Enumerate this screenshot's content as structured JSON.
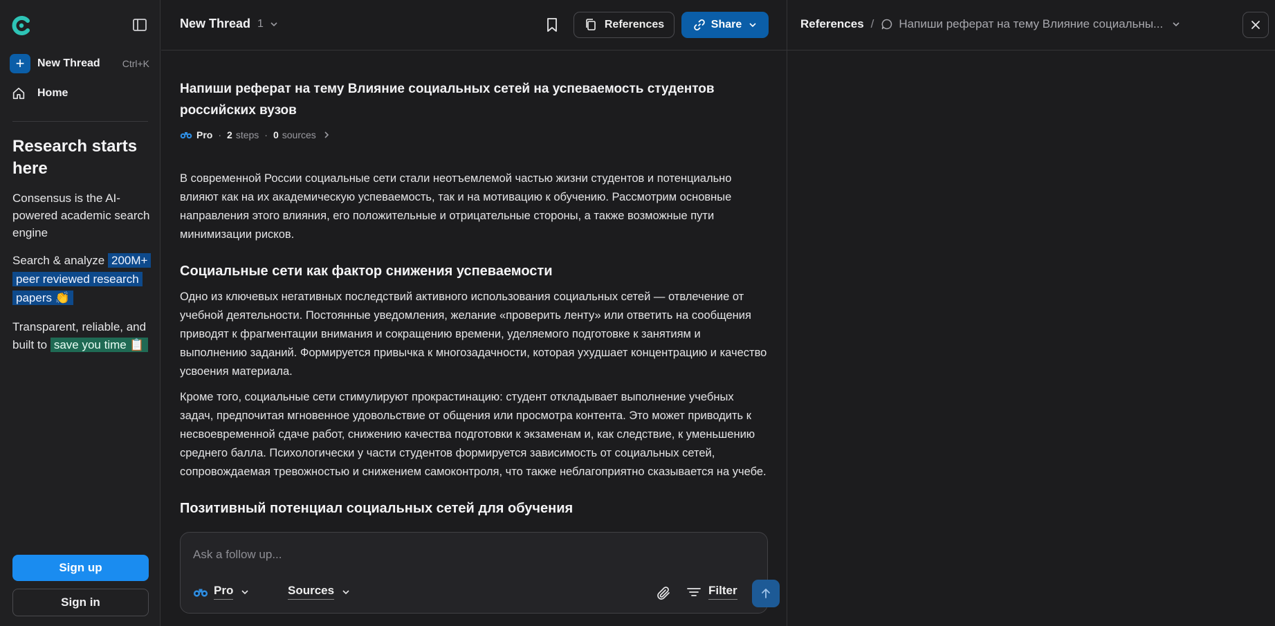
{
  "sidebar": {
    "new_thread_label": "New Thread",
    "new_thread_shortcut": "Ctrl+K",
    "home_label": "Home",
    "promo": {
      "title": "Research starts here",
      "line1": "Consensus is the AI-powered academic search engine",
      "line2_text": "Search & analyze",
      "line2_highlight": "200M+ peer reviewed research papers 👏",
      "line3_text": "Transparent, reliable, and built to",
      "line3_highlight": "save you time 📋"
    },
    "signup_label": "Sign up",
    "signin_label": "Sign in"
  },
  "header": {
    "thread_title": "New Thread",
    "thread_count": "1",
    "references_label": "References",
    "share_label": "Share"
  },
  "thread": {
    "question": "Напиши реферат на тему Влияние социальных сетей на успеваемость студентов российских вузов",
    "meta": {
      "mode": "Pro",
      "steps_count": "2",
      "steps_label": "steps",
      "sources_count": "0",
      "sources_label": "sources"
    },
    "intro": "В современной России социальные сети стали неотъемлемой частью жизни студентов и потенциально влияют как на их академическую успеваемость, так и на мотивацию к обучению. Рассмотрим основные направления этого влияния, его положительные и отрицательные стороны, а также возможные пути минимизации рисков.",
    "section1_heading": "Социальные сети как фактор снижения успеваемости",
    "section1_p1": "Одно из ключевых негативных последствий активного использования социальных сетей — отвлечение от учебной деятельности. Постоянные уведомления, желание «проверить ленту» или ответить на сообщения приводят к фрагментации внимания и сокращению времени, уделяемого подготовке к занятиям и выполнению заданий. Формируется привычка к многозадачности, которая ухудшает концентрацию и качество усвоения материала.",
    "section1_p2": "Кроме того, социальные сети стимулируют прокрастинацию: студент откладывает выполнение учебных задач, предпочитая мгновенное удовольствие от общения или просмотра контента. Это может приводить к несвоевременной сдаче работ, снижению качества подготовки к экзаменам и, как следствие, к уменьшению среднего балла. Психологически у части студентов формируется зависимость от социальных сетей, сопровождаемая тревожностью и снижением самоконтроля, что также неблагоприятно сказывается на учебе.",
    "section2_heading": "Позитивный потенциал социальных сетей для обучения"
  },
  "composer": {
    "placeholder": "Ask a follow up...",
    "pro_label": "Pro",
    "sources_label": "Sources",
    "filter_label": "Filter"
  },
  "references_panel": {
    "title": "References",
    "separator": "/",
    "thread_query": "Напиши реферат на тему Влияние социальны..."
  },
  "colors": {
    "accent": "#1a8cf0",
    "share_bg": "#0b5ea8",
    "highlight_blue": "#0e4a8c",
    "highlight_green": "#1f6a54"
  }
}
